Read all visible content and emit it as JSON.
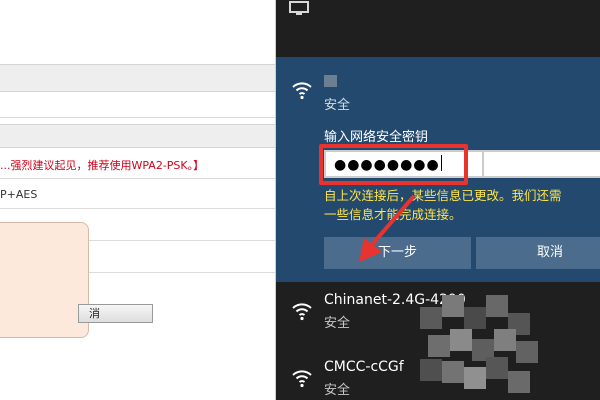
{
  "router_page": {
    "security_warning": "...强烈建议起见，推荐使用WPA2-PSK。】",
    "encryption_value": "P+AES",
    "cancel_button_label": "消"
  },
  "network_flyout": {
    "selected_network": {
      "status": "安全",
      "password_label": "输入网络安全密钥",
      "password_value": "●●●●●●●●",
      "info_text_line1": "自上次连接后，某些信息已更改。我们还需",
      "info_text_line2": "一些信息才能完成连接。",
      "next_button_label": "下一步",
      "cancel_button_label": "取消"
    },
    "networks": [
      {
        "name": "Chinanet-2.4G-4290",
        "status": "安全"
      },
      {
        "name": "CMCC-cCGf",
        "status": "安全"
      }
    ]
  },
  "colors": {
    "flyout_bg": "#1f1f1f",
    "selected_bg": "#234a6e",
    "button_bg": "#4b6c8c",
    "info_text": "#ffe54a",
    "highlight": "#e8332f",
    "router_warning": "#d0021b"
  },
  "icons": [
    "wifi-icon",
    "network-top-icon",
    "annotation-arrow"
  ]
}
